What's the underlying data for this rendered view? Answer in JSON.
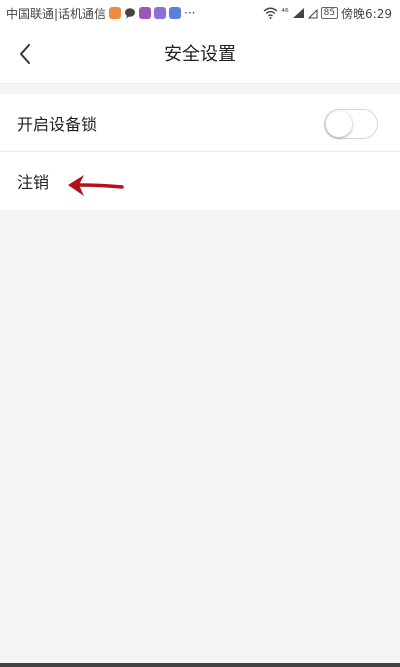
{
  "status_bar": {
    "carrier": "中国联通|话机通信",
    "network": "⁴⁶",
    "battery": "85",
    "time": "傍晚6:29",
    "app_icon_colors": [
      "#f08a3c",
      "#444444",
      "#9b59b6",
      "#8e6fd8",
      "#5a7fe0"
    ]
  },
  "nav": {
    "back_icon": "chevron-left-icon",
    "title": "安全设置"
  },
  "settings": {
    "device_lock_label": "开启设备锁",
    "device_lock_enabled": false,
    "logout_label": "注销"
  },
  "annotation": {
    "arrow_color": "#b3121b"
  }
}
